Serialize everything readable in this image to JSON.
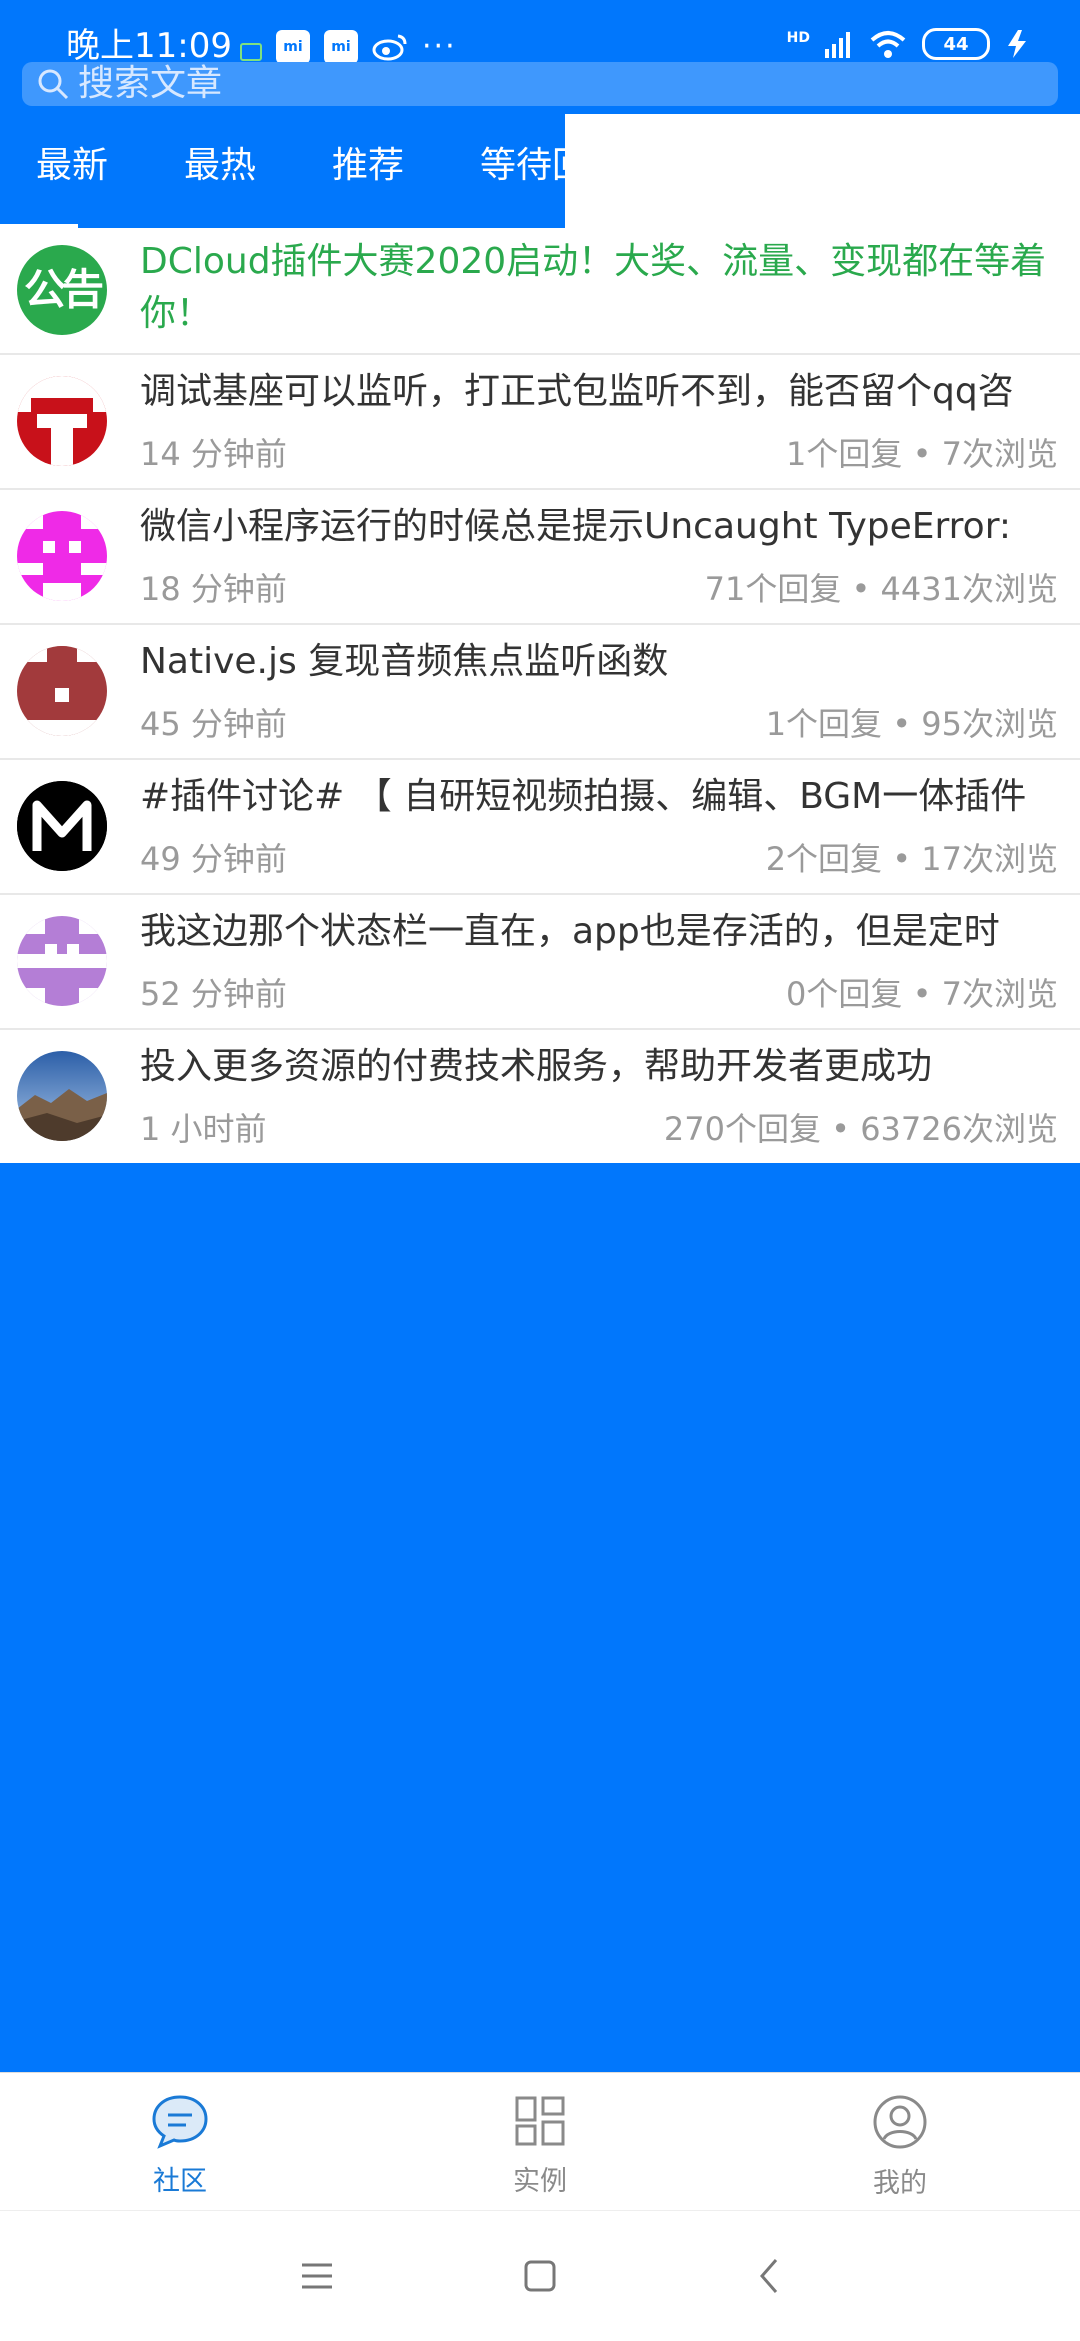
{
  "status_bar": {
    "time": "晚上11:09",
    "notif_app_label": "mi",
    "more_icon": "···",
    "hd_label": "HD",
    "battery": "44"
  },
  "search": {
    "placeholder": "搜索文章"
  },
  "tabs": [
    {
      "label": "最新",
      "active": true
    },
    {
      "label": "最热",
      "active": false
    },
    {
      "label": "推荐",
      "active": false
    },
    {
      "label": "等待回",
      "active": false
    }
  ],
  "announcement": {
    "badge": "公告",
    "title": "DCloud插件大赛2020启动！大奖、流量、变现都在等着你！"
  },
  "posts": [
    {
      "title": "调试基座可以监听，打正式包监听不到，能否留个qq咨",
      "time": "14 分钟前",
      "stats": "1个回复 • 7次浏览",
      "avatar_color": "#c8111a",
      "avatar_icon": "identicon-red"
    },
    {
      "title": "微信小程序运行的时候总是提示Uncaught TypeError:",
      "time": "18 分钟前",
      "stats": "71个回复 • 4431次浏览",
      "avatar_color": "#ef2ae7",
      "avatar_icon": "identicon-magenta"
    },
    {
      "title": "Native.js 复现音频焦点监听函数",
      "time": "45 分钟前",
      "stats": "1个回复 • 95次浏览",
      "avatar_color": "#a23a3c",
      "avatar_icon": "identicon-brown"
    },
    {
      "title": "#插件讨论# 【 自研短视频拍摄、编辑、BGM一体插件",
      "time": "49 分钟前",
      "stats": "2个回复 • 17次浏览",
      "avatar_color": "#000000",
      "avatar_icon": "m-logo"
    },
    {
      "title": "我这边那个状态栏一直在，app也是存活的，但是定时",
      "time": "52 分钟前",
      "stats": "0个回复 • 7次浏览",
      "avatar_color": "#b47ed6",
      "avatar_icon": "identicon-purple"
    },
    {
      "title": "投入更多资源的付费技术服务，帮助开发者更成功",
      "time": "1 小时前",
      "stats": "270个回复 • 63726次浏览",
      "avatar_color": "#5b83b8",
      "avatar_icon": "landscape-photo"
    }
  ],
  "bottom_nav": [
    {
      "label": "社区",
      "icon": "chat-icon",
      "active": true
    },
    {
      "label": "实例",
      "icon": "grid-icon",
      "active": false
    },
    {
      "label": "我的",
      "icon": "user-icon",
      "active": false
    }
  ],
  "colors": {
    "primary": "#0177fc",
    "announcement": "#2aa94d",
    "muted": "#9a9a9a",
    "nav_active": "#1a7ad6",
    "nav_inactive": "#8a8a8a"
  }
}
